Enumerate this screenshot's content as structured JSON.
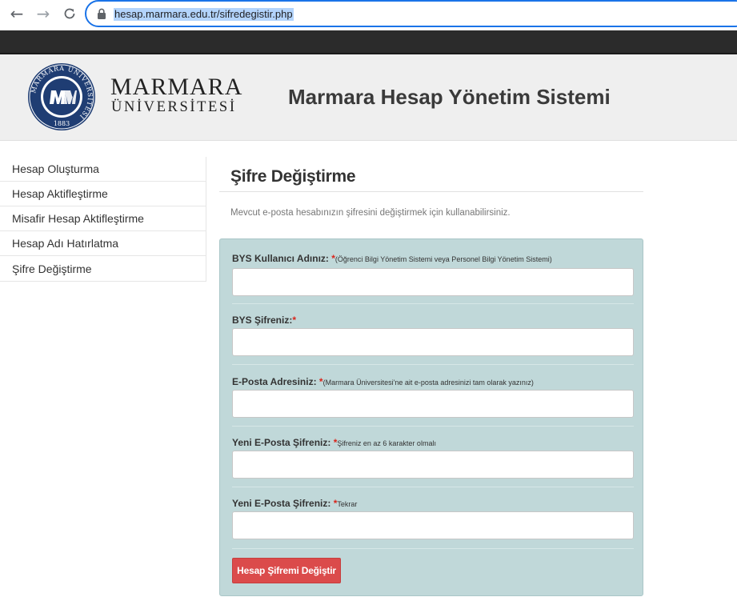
{
  "browser": {
    "url": "hesap.marmara.edu.tr/sifredegistir.php"
  },
  "header": {
    "logo_title": "MARMARA",
    "logo_subtitle": "ÜNİVERSİTESİ",
    "seal_text_top": "MARMARA ÜNİVERSİTESİ",
    "seal_year": "1883",
    "system_title": "Marmara Hesap Yönetim Sistemi"
  },
  "sidebar": {
    "items": [
      {
        "label": "Hesap Oluşturma"
      },
      {
        "label": "Hesap Aktifleştirme"
      },
      {
        "label": "Misafir Hesap Aktifleştirme"
      },
      {
        "label": "Hesap Adı Hatırlatma"
      },
      {
        "label": "Şifre Değiştirme"
      }
    ]
  },
  "main": {
    "title": "Şifre Değiştirme",
    "intro": "Mevcut e-posta hesabınızın şifresini değiştirmek için kullanabilirsiniz.",
    "fields": [
      {
        "label": "BYS Kullanıcı Adınız:",
        "required": "*",
        "hint": "(Öğrenci Bilgi Yönetim Sistemi veya Personel Bilgi Yönetim Sistemi)",
        "value": ""
      },
      {
        "label": "BYS Şifreniz:",
        "required": "*",
        "hint": "",
        "value": ""
      },
      {
        "label": "E-Posta Adresiniz:",
        "required": "*",
        "hint": "(Marmara Üniversitesi'ne ait e-posta adresinizi tam olarak yazınız)",
        "value": ""
      },
      {
        "label": "Yeni E-Posta Şifreniz:",
        "required": "*",
        "hint": "Şifreniz en az 6 karakter olmalı",
        "value": ""
      },
      {
        "label": "Yeni E-Posta Şifreniz:",
        "required": "*",
        "hint": "Tekrar",
        "value": ""
      }
    ],
    "submit_label": "Hesap Şifremi Değiştir"
  },
  "colors": {
    "panel": "#c0d8d9",
    "button": "#db4b4b",
    "seal": "#1f3d73",
    "required": "#d9261c"
  }
}
